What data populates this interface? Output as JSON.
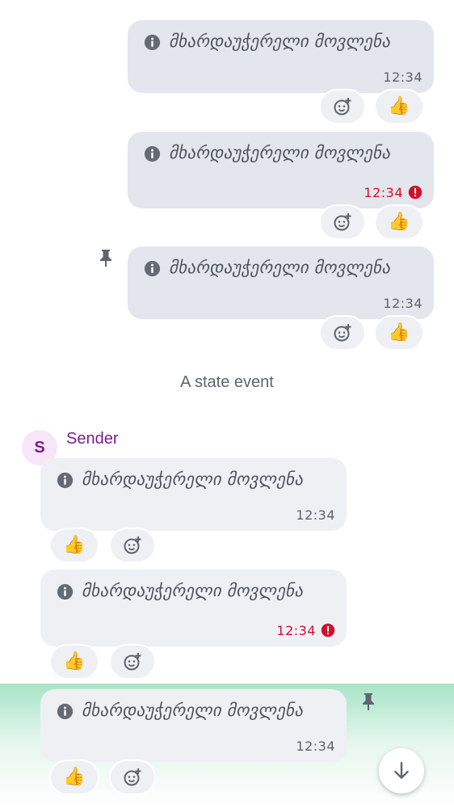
{
  "messages_out": [
    {
      "text": "მხარდაუჭერელი მოვლენა",
      "time": "12:34",
      "error": false,
      "pinned": false,
      "reaction": "👍"
    },
    {
      "text": "მხარდაუჭერელი მოვლენა",
      "time": "12:34",
      "error": true,
      "pinned": false,
      "reaction": "👍"
    },
    {
      "text": "მხარდაუჭერელი მოვლენა",
      "time": "12:34",
      "error": false,
      "pinned": true,
      "reaction": "👍"
    }
  ],
  "state_event": "A state event",
  "sender": {
    "initial": "S",
    "name": "Sender",
    "color": "#7b1c8f"
  },
  "messages_in": [
    {
      "text": "მხარდაუჭერელი მოვლენა",
      "time": "12:34",
      "error": false,
      "pinned": false,
      "reaction": "👍"
    },
    {
      "text": "მხარდაუჭერელი მოვლენა",
      "time": "12:34",
      "error": true,
      "pinned": false,
      "reaction": "👍"
    },
    {
      "text": "მხარდაუჭერელი მოვლენა",
      "time": "12:34",
      "error": false,
      "pinned": true,
      "reaction": "👍"
    }
  ],
  "colors": {
    "error": "#d0112b",
    "bubble_out": "#e3e6ec",
    "bubble_in": "#eef0f4",
    "highlight": "#a8e4c7"
  },
  "icons": {
    "info": "info-icon",
    "error": "error-icon",
    "pin": "pin-icon",
    "add_reaction": "add-reaction-icon",
    "scroll_down": "arrow-down-icon"
  }
}
